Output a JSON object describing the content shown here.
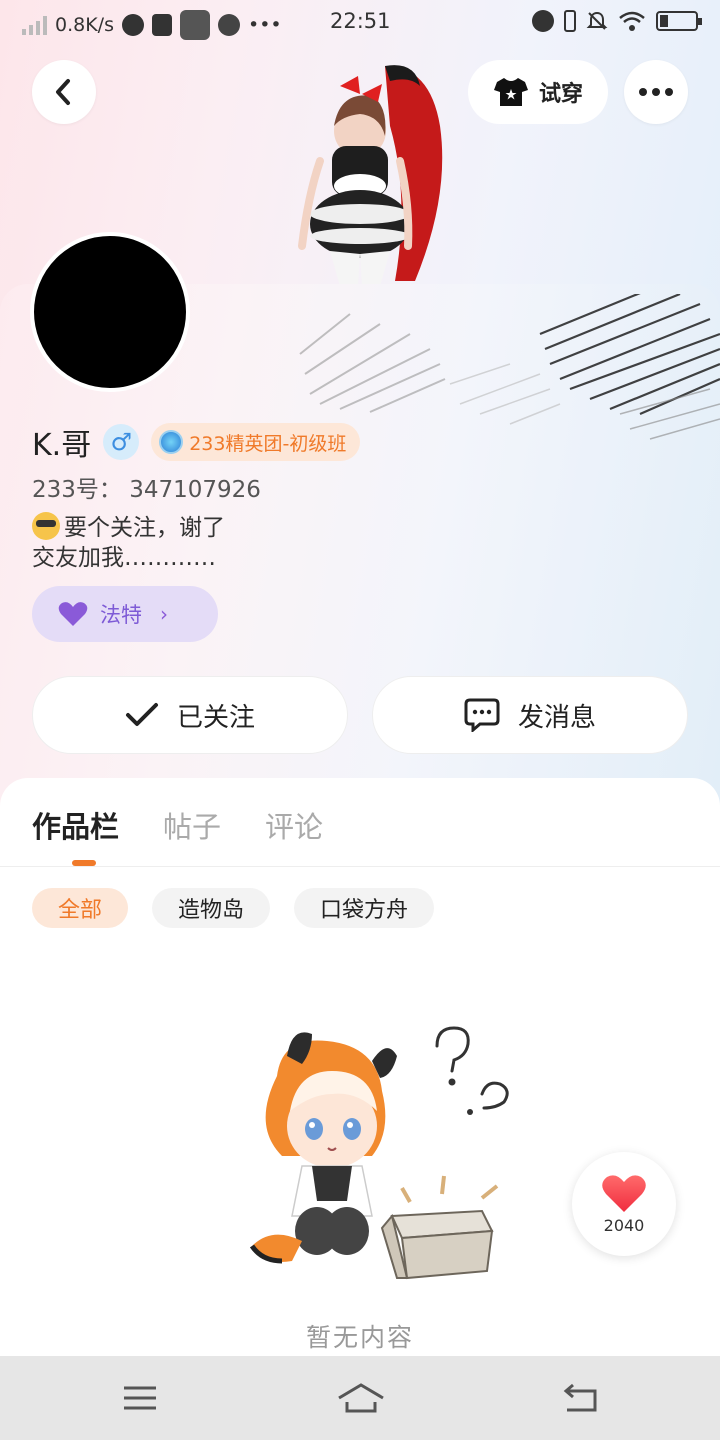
{
  "status_bar": {
    "net_speed": "0.8K/s",
    "time": "22:51",
    "more": "•••"
  },
  "header": {
    "try_on_label": "试穿"
  },
  "profile": {
    "name": "K.哥",
    "gender_symbol": "♂",
    "badge": "233精英团-初级班",
    "id_line": "233号： 347107926",
    "bio_line1": "要个关注，谢了",
    "bio_line2": "交友加我…………",
    "fate_label": "法特",
    "fate_arrow": "›"
  },
  "actions": {
    "follow_label": "已关注",
    "message_label": "发消息"
  },
  "tabs": [
    {
      "label": "作品栏",
      "active": true
    },
    {
      "label": "帖子",
      "active": false
    },
    {
      "label": "评论",
      "active": false
    }
  ],
  "filters": [
    {
      "label": "全部",
      "active": true
    },
    {
      "label": "造物岛",
      "active": false
    },
    {
      "label": "口袋方舟",
      "active": false
    }
  ],
  "empty_state": {
    "text": "暂无内容"
  },
  "like": {
    "count": "2040"
  },
  "colors": {
    "accent_orange": "#f07a2a",
    "fate_purple": "#8a5ad8",
    "gender_blue": "#3d8ee0"
  }
}
